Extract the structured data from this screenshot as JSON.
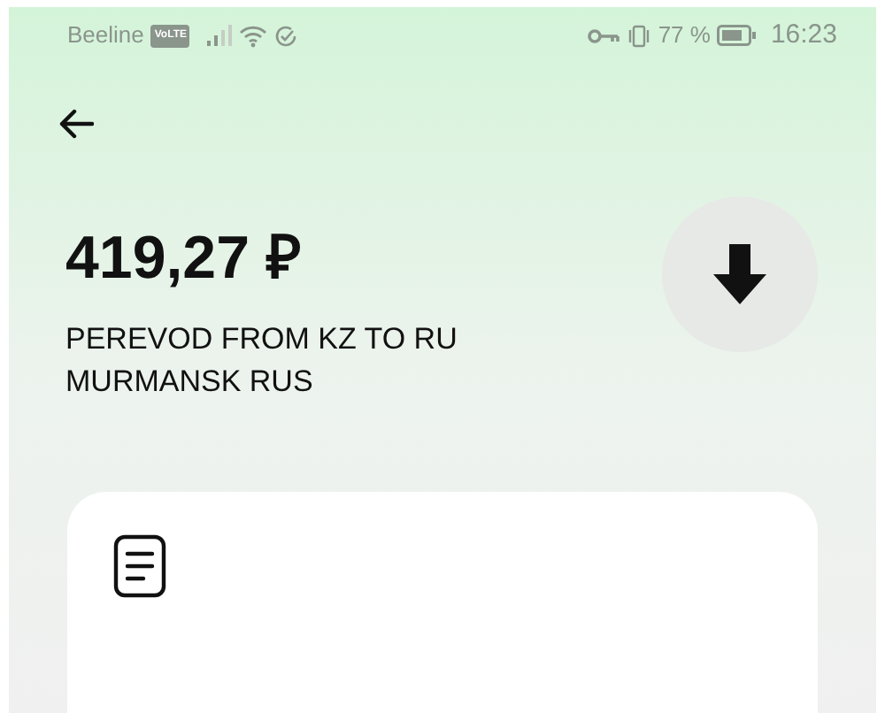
{
  "status_bar": {
    "carrier": "Beeline",
    "network_badge": "VoLTE",
    "battery_percent": "77 %",
    "time": "16:23"
  },
  "transaction": {
    "amount": "419,27 ₽",
    "description": "PEREVOD FROM KZ TO RU MURMANSK RUS"
  }
}
